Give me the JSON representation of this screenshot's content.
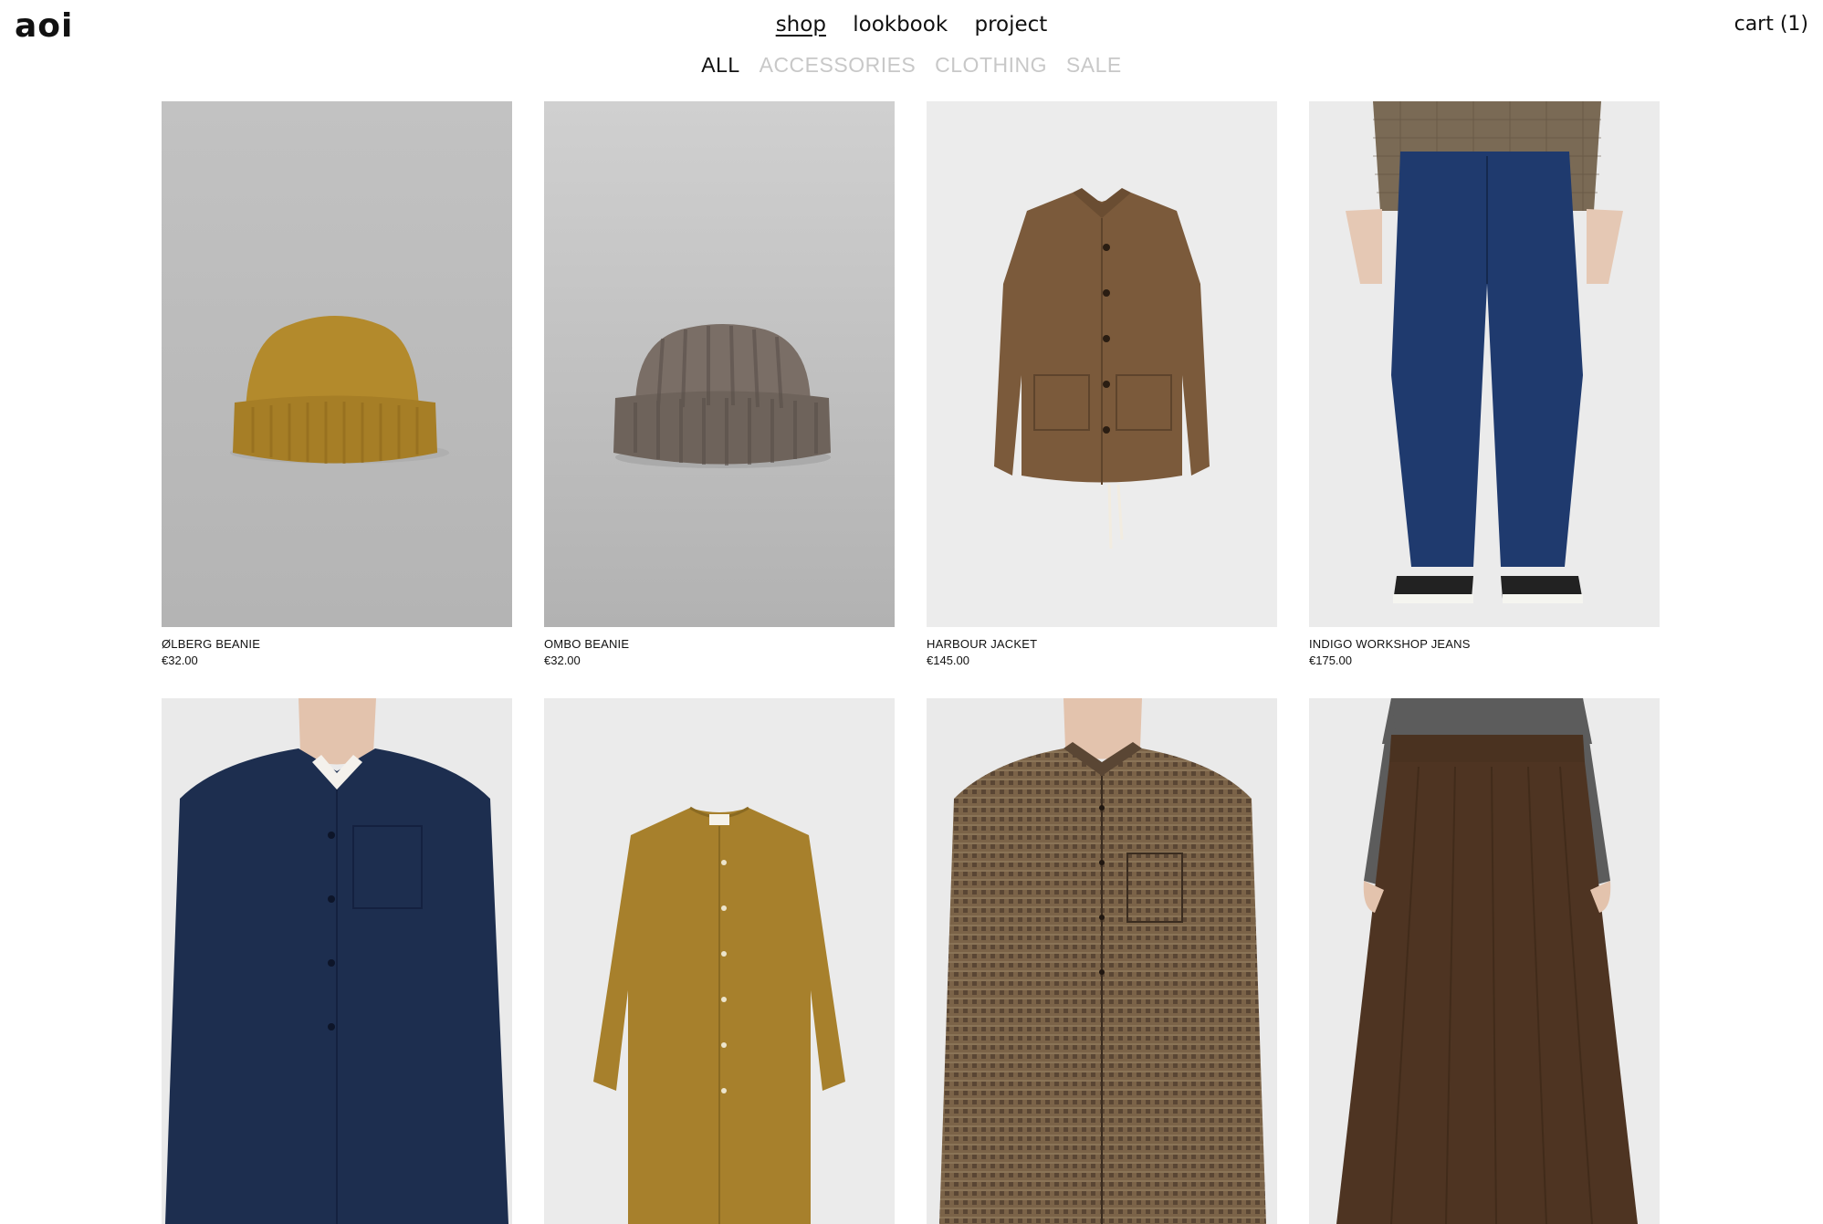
{
  "header": {
    "logo": "aoi",
    "nav": [
      {
        "label": "shop",
        "active": true
      },
      {
        "label": "lookbook",
        "active": false
      },
      {
        "label": "project",
        "active": false
      }
    ],
    "cart_label": "cart (1)"
  },
  "filters": [
    {
      "label": "ALL",
      "active": true
    },
    {
      "label": "ACCESSORIES",
      "active": false
    },
    {
      "label": "CLOTHING",
      "active": false
    },
    {
      "label": "SALE",
      "active": false
    }
  ],
  "products": [
    {
      "name": "ØLBERG BEANIE",
      "price": "€32.00",
      "icon": "mustard-beanie-photo"
    },
    {
      "name": "OMBO BEANIE",
      "price": "€32.00",
      "icon": "grey-beanie-photo"
    },
    {
      "name": "HARBOUR JACKET",
      "price": "€145.00",
      "icon": "brown-jacket-photo"
    },
    {
      "name": "INDIGO WORKSHOP JEANS",
      "price": "€175.00",
      "icon": "indigo-jeans-photo"
    },
    {
      "name": "",
      "price": "",
      "icon": "navy-jacket-model-photo"
    },
    {
      "name": "",
      "price": "",
      "icon": "mustard-shirt-photo"
    },
    {
      "name": "",
      "price": "",
      "icon": "check-shirt-model-photo"
    },
    {
      "name": "",
      "price": "",
      "icon": "brown-skirt-model-photo"
    }
  ],
  "colors": {
    "text": "#111111",
    "inactive_filter": "#c8c8c8",
    "photo_bg_grey": "#bebebe",
    "photo_bg_light": "#ededed"
  }
}
